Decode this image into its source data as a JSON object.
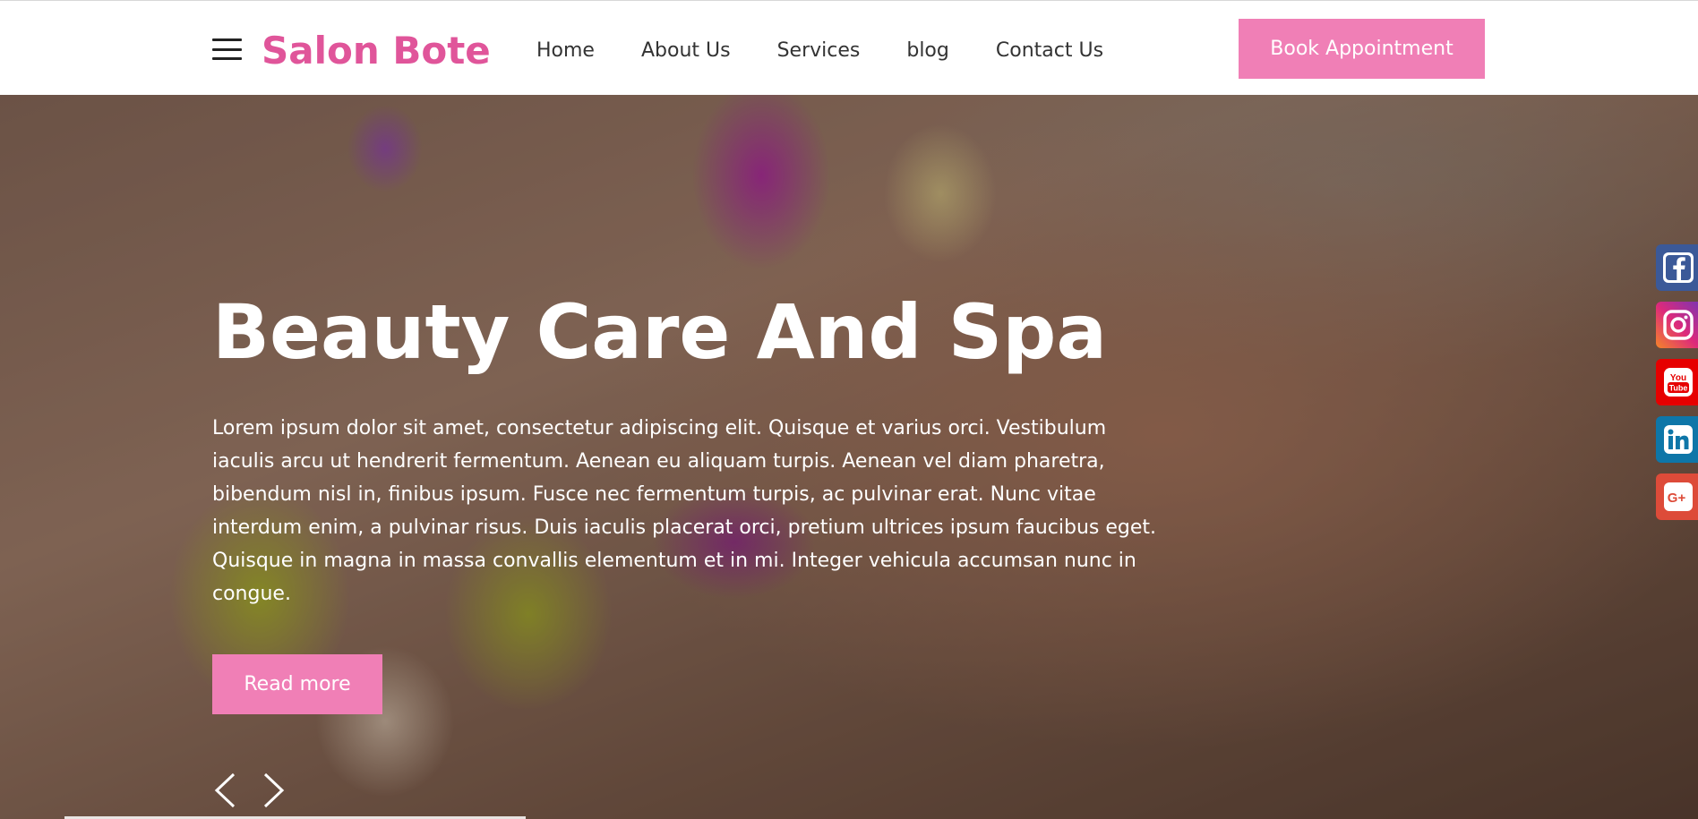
{
  "header": {
    "logo": "Salon Bote",
    "nav": [
      "Home",
      "About Us",
      "Services",
      "blog",
      "Contact Us"
    ],
    "book_label": "Book Appointment"
  },
  "hero": {
    "title": "Beauty Care And Spa",
    "text": "Lorem ipsum dolor sit amet, consectetur adipiscing elit. Quisque et varius orci. Vestibulum iaculis arcu ut hendrerit fermentum. Aenean eu aliquam turpis. Aenean vel diam pharetra, bibendum nisl in, finibus ipsum. Fusce nec fermentum turpis, ac pulvinar erat. Nunc vitae interdum enim, a pulvinar risus. Duis iaculis placerat orci, pretium ultrices ipsum faucibus eget. Quisque in magna in massa convallis elementum et in mi. Integer vehicula accumsan nunc in congue.",
    "read_more_label": "Read more",
    "prev_icon": "chevron-left-icon",
    "next_icon": "chevron-right-icon"
  },
  "social": [
    {
      "name": "facebook-icon",
      "color": "#3b5998"
    },
    {
      "name": "instagram-icon",
      "color": "#e1306c"
    },
    {
      "name": "youtube-icon",
      "color": "#ff0000"
    },
    {
      "name": "linkedin-icon",
      "color": "#0e76a8"
    },
    {
      "name": "google-plus-icon",
      "color": "#dd4b39"
    }
  ],
  "colors": {
    "brand_pink": "#e0559a",
    "button_pink": "#f07fb6"
  }
}
